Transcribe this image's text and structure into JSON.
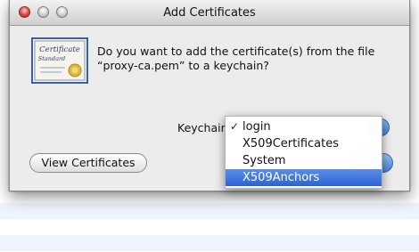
{
  "window": {
    "title": "Add Certificates"
  },
  "message": {
    "line1": "Do you want to add the certificate(s) from the file",
    "line2": "“proxy-ca.pem” to a keychain?"
  },
  "cert_icon": {
    "title_text": "Certificate",
    "subtitle_text": "Standard"
  },
  "keychain": {
    "label": "Keychain",
    "selected": "login",
    "check_glyph": "✓",
    "options": [
      "login",
      "X509Certificates",
      "System",
      "X509Anchors"
    ],
    "highlighted": "X509Anchors"
  },
  "buttons": {
    "view_certificates": "View Certificates"
  },
  "colors": {
    "highlight": "#3a6fd8",
    "accent_button": "#3f7fd8",
    "window_bg": "#ececec"
  }
}
